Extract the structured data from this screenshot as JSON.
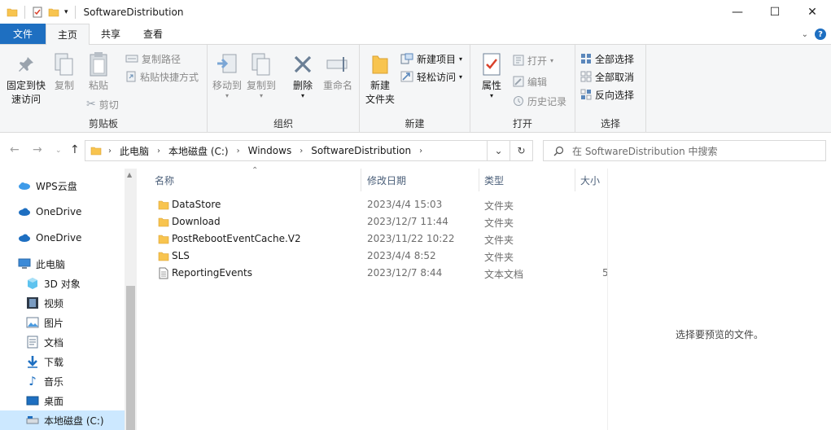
{
  "window": {
    "title": "SoftwareDistribution",
    "controls": {
      "minimize": "—",
      "maximize": "☐",
      "close": "✕"
    }
  },
  "tabs": [
    {
      "label": "文件"
    },
    {
      "label": "主页"
    },
    {
      "label": "共享"
    },
    {
      "label": "查看"
    }
  ],
  "ribbon": {
    "clipboard": {
      "label": "剪贴板",
      "pin_line1": "固定到快",
      "pin_line2": "速访问",
      "copy": "复制",
      "paste": "粘贴",
      "copy_path": "复制路径",
      "paste_shortcut": "粘贴快捷方式",
      "cut": "剪切"
    },
    "organize": {
      "label": "组织",
      "move_to": "移动到",
      "copy_to": "复制到",
      "delete": "删除",
      "rename": "重命名"
    },
    "new": {
      "label": "新建",
      "new_folder_line1": "新建",
      "new_folder_line2": "文件夹",
      "new_item": "新建项目",
      "easy_access": "轻松访问"
    },
    "open": {
      "label": "打开",
      "properties": "属性",
      "open": "打开",
      "edit": "编辑",
      "history": "历史记录"
    },
    "select": {
      "label": "选择",
      "select_all": "全部选择",
      "select_none": "全部取消",
      "invert": "反向选择"
    }
  },
  "address": {
    "crumbs": [
      "此电脑",
      "本地磁盘 (C:)",
      "Windows",
      "SoftwareDistribution"
    ],
    "search_placeholder": "在 SoftwareDistribution 中搜索"
  },
  "nav": {
    "items": [
      {
        "label": "WPS云盘"
      },
      {
        "label": "OneDrive"
      },
      {
        "label": "OneDrive"
      },
      {
        "label": "此电脑"
      },
      {
        "label": "3D 对象"
      },
      {
        "label": "视频"
      },
      {
        "label": "图片"
      },
      {
        "label": "文档"
      },
      {
        "label": "下载"
      },
      {
        "label": "音乐"
      },
      {
        "label": "桌面"
      },
      {
        "label": "本地磁盘 (C:)"
      }
    ]
  },
  "columns": {
    "name": "名称",
    "date": "修改日期",
    "type": "类型",
    "size": "大小"
  },
  "files": [
    {
      "name": "DataStore",
      "date": "2023/4/4 15:03",
      "type": "文件夹",
      "size": ""
    },
    {
      "name": "Download",
      "date": "2023/12/7 11:44",
      "type": "文件夹",
      "size": ""
    },
    {
      "name": "PostRebootEventCache.V2",
      "date": "2023/11/22 10:22",
      "type": "文件夹",
      "size": ""
    },
    {
      "name": "SLS",
      "date": "2023/4/4 8:52",
      "type": "文件夹",
      "size": ""
    },
    {
      "name": "ReportingEvents",
      "date": "2023/12/7 8:44",
      "type": "文本文档",
      "size": "5"
    }
  ],
  "preview_text": "选择要预览的文件。",
  "colors": {
    "accent": "#1e6fc1",
    "folder": "#f8c44f",
    "selection": "#cce8ff"
  }
}
